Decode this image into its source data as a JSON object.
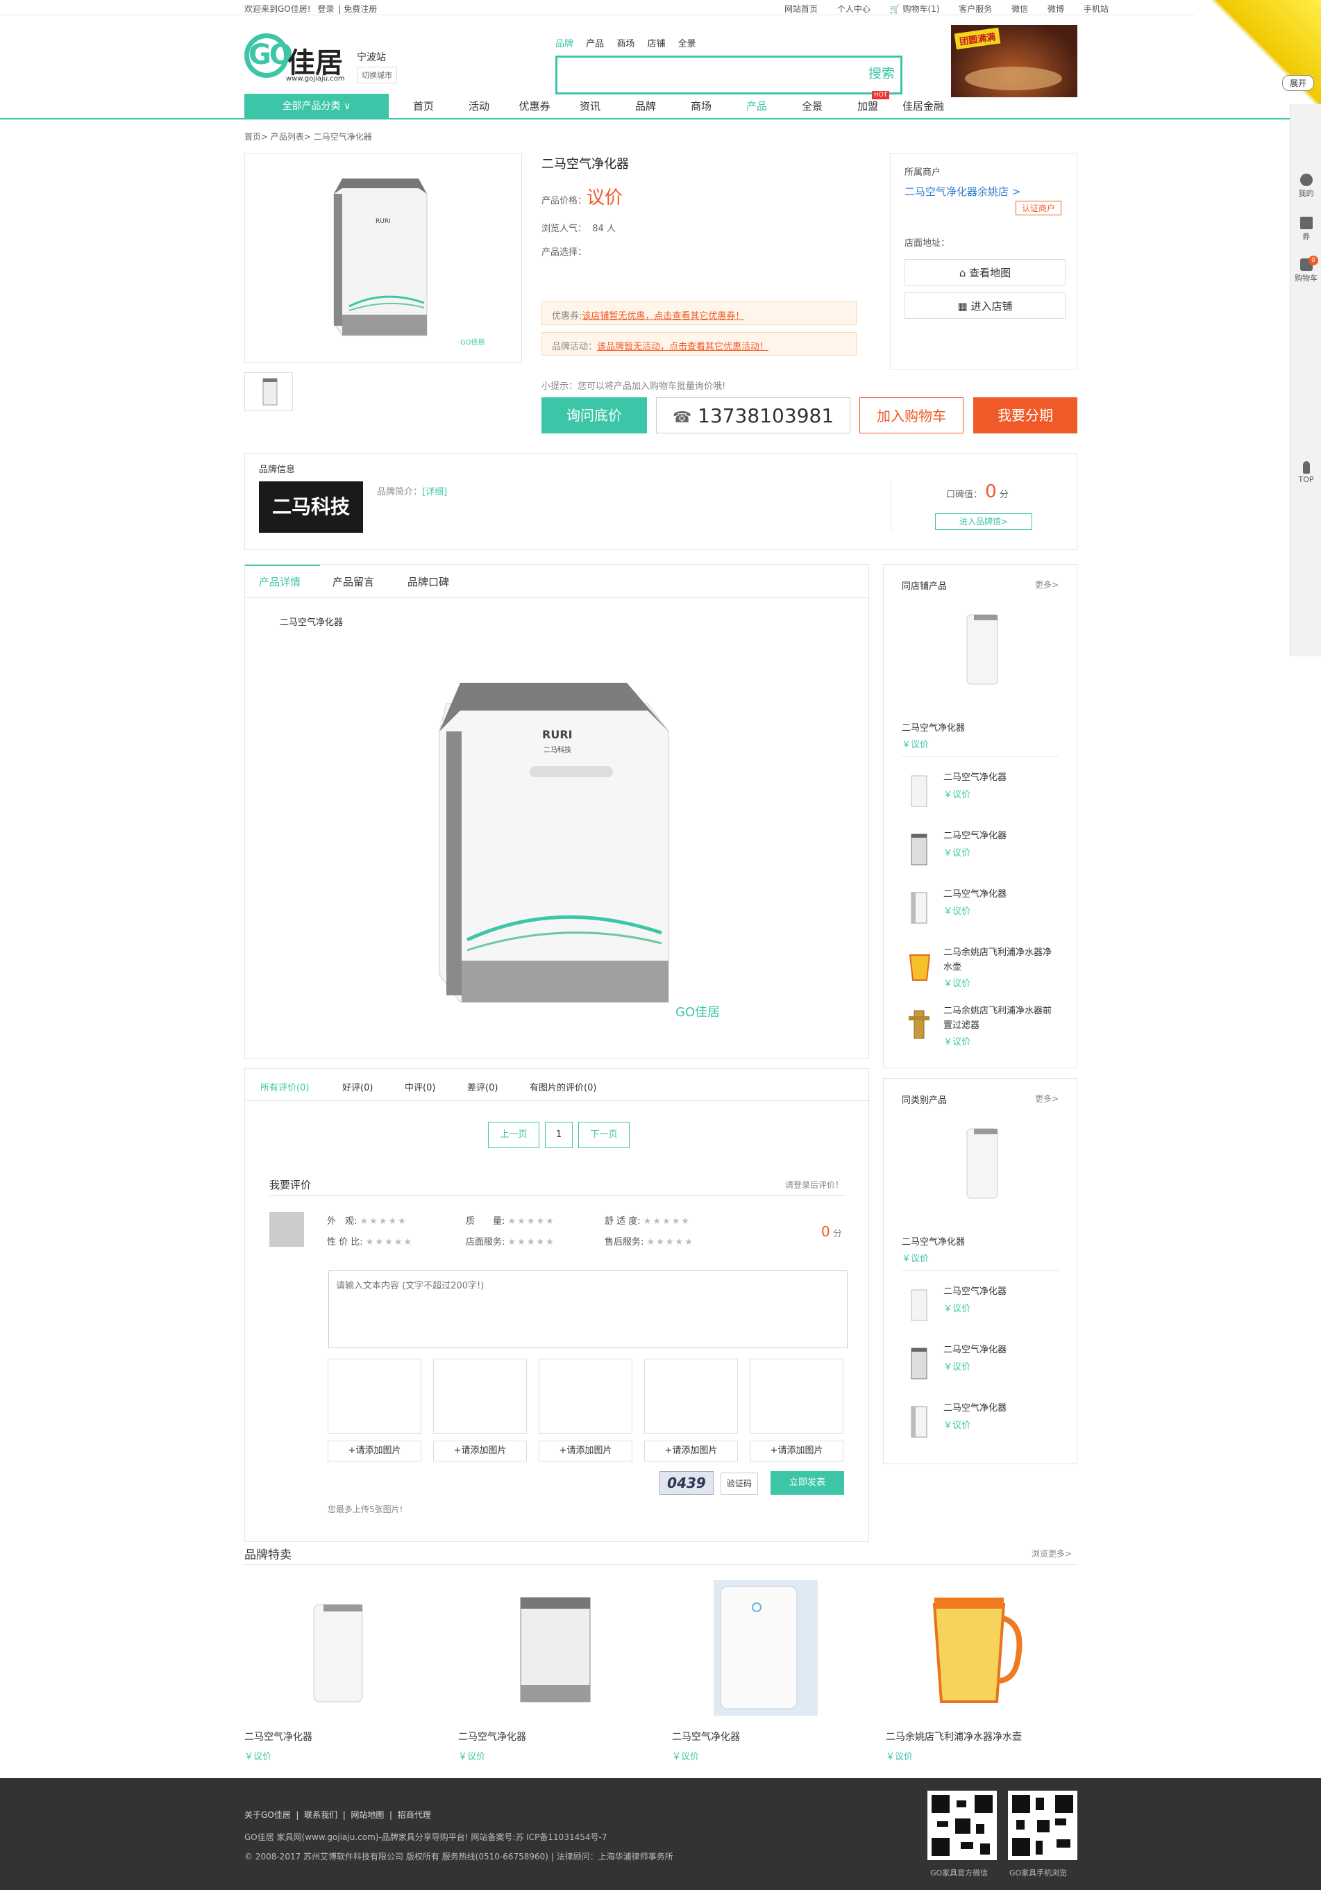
{
  "topbar": {
    "welcome": "欢迎来到GO佳居!",
    "login": "登录",
    "register": "免费注册",
    "links": [
      "网站首页",
      "个人中心",
      "购物车(1)",
      "客户服务",
      "微信",
      "微博",
      "手机站"
    ]
  },
  "header": {
    "logo_go": "GO",
    "logo_cn": "佳居",
    "logo_url": "www.gojiaju.com",
    "city": "宁波站",
    "switch_city": "切换城市",
    "search_tabs": [
      "品牌",
      "产品",
      "商场",
      "店铺",
      "全景"
    ],
    "search_btn": "搜索",
    "ad_text": "团圆满满",
    "corner_open": "展开"
  },
  "nav": {
    "all": "全部产品分类 ∨",
    "items": [
      "首页",
      "活动",
      "优惠券",
      "资讯",
      "品牌",
      "商场",
      "产品",
      "全景",
      "加盟",
      "佳居金融"
    ],
    "hot": "HOT"
  },
  "sidebar": {
    "mine": "我的",
    "coupon": "券",
    "cart": "购物车",
    "cart_count": "0",
    "top": "TOP"
  },
  "breadcrumb": "首页> 产品列表> 二马空气净化器",
  "product": {
    "title": "二马空气净化器",
    "price_label": "产品价格：",
    "price": "议价",
    "views_label": "浏览人气：",
    "views": "84 人",
    "select_label": "产品选择：",
    "coupon_label": "优惠券:",
    "coupon_link": "该店铺暂无优惠，点击查看其它优惠券！",
    "activity_label": "品牌活动：",
    "activity_link": "该品牌暂无活动，点击查看其它优惠活动！",
    "tip": "小提示：您可以将产品加入购物车批量询价哦!",
    "btn_ask": "询问底价",
    "phone": "13738103981",
    "btn_cart": "加入购物车",
    "btn_install": "我要分期",
    "img_brand": "RURI",
    "img_brand_cn": "二马科技",
    "img_watermark": "GO佳居"
  },
  "shop": {
    "owner_label": "所属商户",
    "owner": "二马空气净化器余姚店 >",
    "cert": "认证商户",
    "addr_label": "店面地址：",
    "btn_map": "查看地图",
    "btn_shop": "进入店铺"
  },
  "brand": {
    "title": "品牌信息",
    "logo": "二马科技",
    "intro_label": "品牌简介：",
    "detail": "[详细]",
    "score_label": "口碑值：",
    "score": "0",
    "score_unit": "分",
    "enter": "进入品牌馆>"
  },
  "tabs": [
    "产品详情",
    "产品留言",
    "品牌口碑"
  ],
  "detail_caption": "二马空气净化器",
  "reviews": {
    "tabs": [
      "所有评价(0)",
      "好评(0)",
      "中评(0)",
      "差评(0)",
      "有图片的评价(0)"
    ],
    "prev": "上一页",
    "page": "1",
    "next": "下一页",
    "my_review": "我要评价",
    "login_hint": "请登录后评价！",
    "criteria": [
      "外　观:",
      "质　　量:",
      "舒 适 度:",
      "性 价 比:",
      "店面服务:",
      "售后服务:"
    ],
    "score": "0",
    "score_unit": "分",
    "textarea_placeholder": "请输入文本内容 (文字不超过200字!)",
    "add_image": "+请添加图片",
    "captcha": "0439",
    "verify": "验证码",
    "submit": "立即发表",
    "max_hint": "您最多上传5张图片!"
  },
  "same_shop": {
    "title": "同店铺产品",
    "more": "更多>",
    "featured": {
      "name": "二马空气净化器",
      "price": "￥议价"
    },
    "items": [
      {
        "name": "二马空气净化器",
        "price": "￥议价"
      },
      {
        "name": "二马空气净化器",
        "price": "￥议价"
      },
      {
        "name": "二马空气净化器",
        "price": "￥议价"
      },
      {
        "name": "二马余姚店飞利浦净水器净水壶",
        "price": "￥议价"
      },
      {
        "name": "二马余姚店飞利浦净水器前置过滤器",
        "price": "￥议价"
      }
    ]
  },
  "same_cat": {
    "title": "同类别产品",
    "more": "更多>",
    "featured": {
      "name": "二马空气净化器",
      "price": "￥议价"
    },
    "items": [
      {
        "name": "二马空气净化器",
        "price": "￥议价"
      },
      {
        "name": "二马空气净化器",
        "price": "￥议价"
      },
      {
        "name": "二马空气净化器",
        "price": "￥议价"
      }
    ]
  },
  "special": {
    "title": "品牌特卖",
    "more": "浏览更多>",
    "items": [
      {
        "name": "二马空气净化器",
        "price": "￥议价"
      },
      {
        "name": "二马空气净化器",
        "price": "￥议价"
      },
      {
        "name": "二马空气净化器",
        "price": "￥议价"
      },
      {
        "name": "二马余姚店飞利浦净水器净水壶",
        "price": "￥议价"
      }
    ]
  },
  "footer": {
    "links": [
      "关于GO佳居",
      "联系我们",
      "网站地图",
      "招商代理"
    ],
    "line1": "GO佳居 家具网(www.gojiaju.com)-品牌家具分享导购平台! 网站备案号:苏 ICP备11031454号-7",
    "line2": "© 2008-2017 苏州艾博软件科技有限公司 版权所有 服务热线(0510-66758960) | 法律顾问：上海华浦律师事务所",
    "qr1": "GO家具官方微信",
    "qr2": "GO家具手机浏览"
  },
  "colors": {
    "accent": "#3cc6a7",
    "orange": "#f05a28",
    "footer": "#333333"
  }
}
